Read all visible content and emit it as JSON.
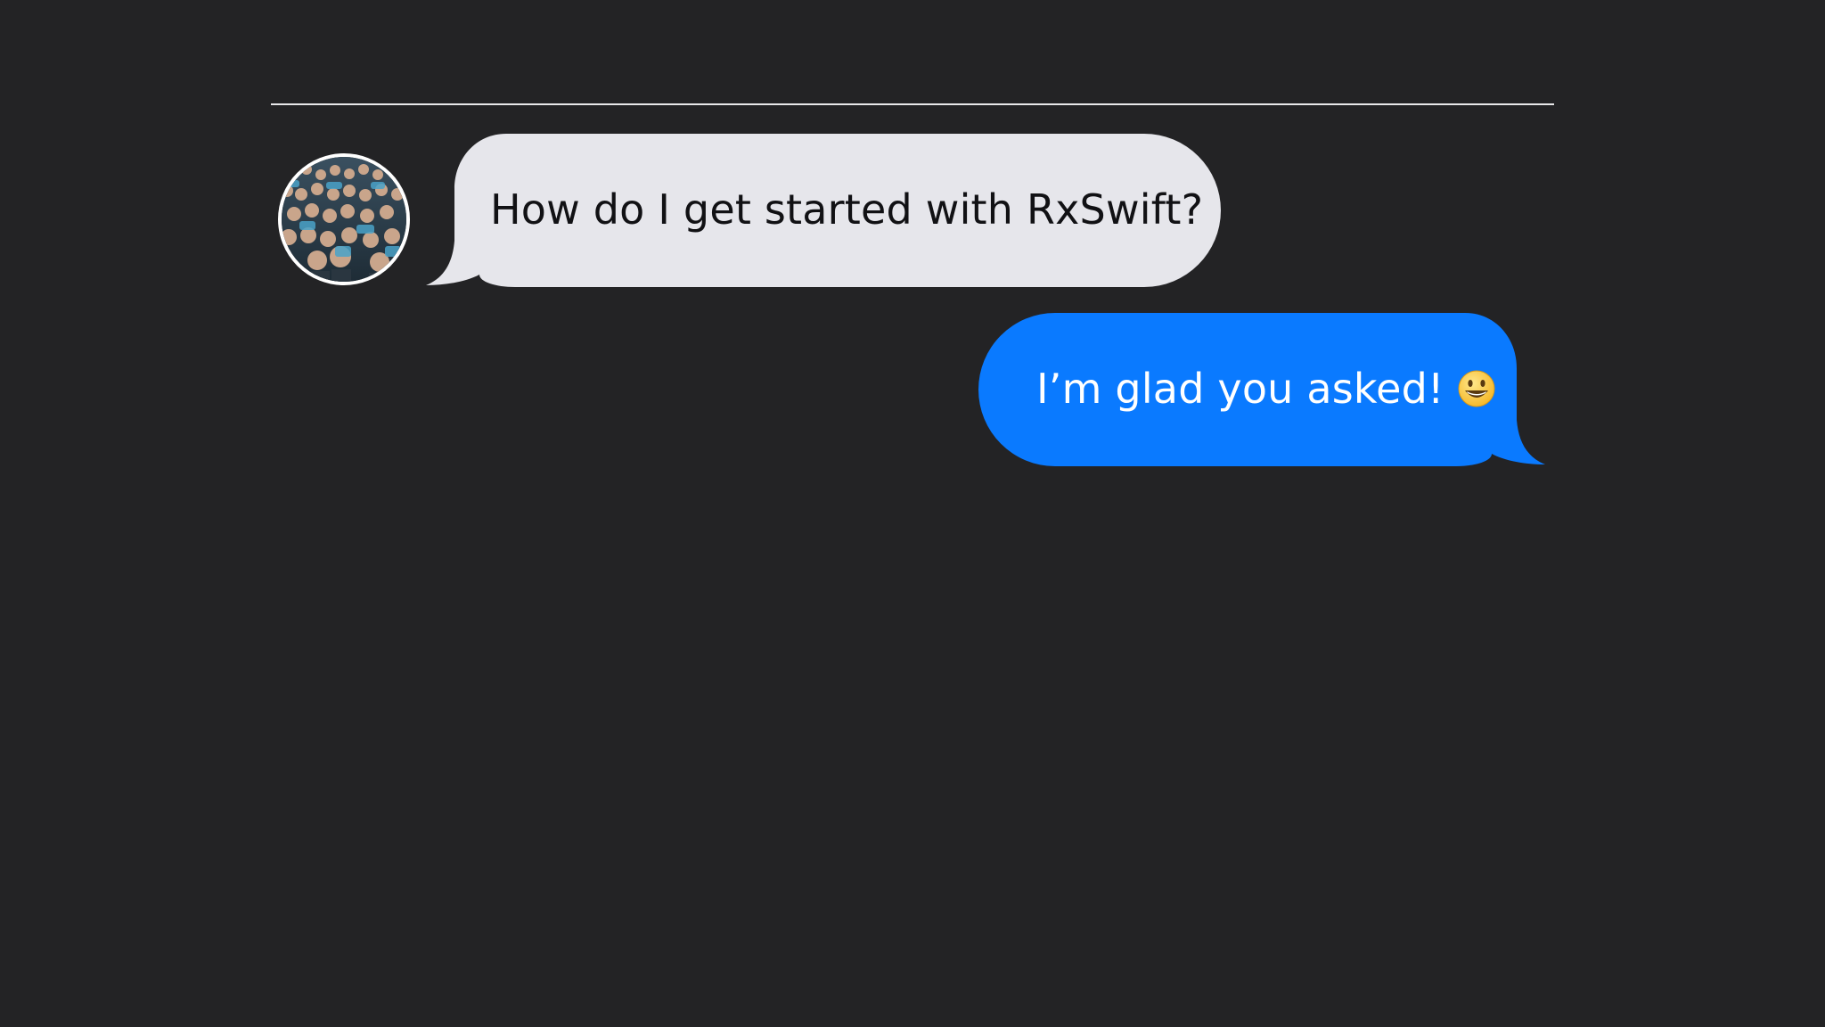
{
  "conversation": {
    "messages": [
      {
        "direction": "incoming",
        "text": "How do I get started with RxSwift?",
        "bubble_color": "#e6e6eb",
        "text_color": "#111114"
      },
      {
        "direction": "outgoing",
        "text": "I’m glad you asked!",
        "emoji": "grinning-face-emoji",
        "bubble_color": "#0a7aff",
        "text_color": "#ffffff"
      }
    ],
    "avatar": "crowd-photo-avatar"
  },
  "theme": {
    "background": "#232325",
    "divider": "#e8e8ea"
  }
}
